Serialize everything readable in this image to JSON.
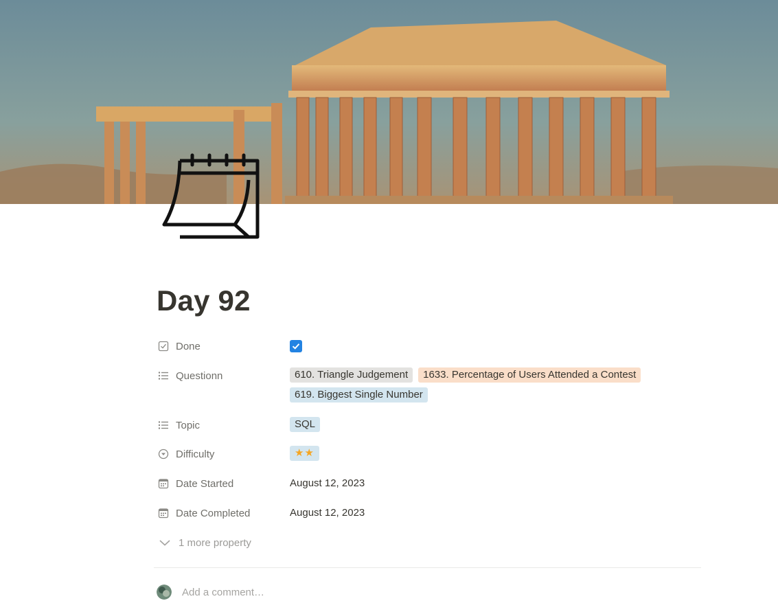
{
  "page": {
    "title": "Day 92",
    "icon": "calendar-icon",
    "cover": "parthenon-painting"
  },
  "properties": {
    "done": {
      "label": "Done",
      "icon": "checkbox-icon",
      "checked": true
    },
    "question": {
      "label": "Questionn",
      "icon": "list-icon",
      "tags": [
        {
          "text": "610. Triangle Judgement",
          "color": "#e3e2e0"
        },
        {
          "text": "1633. Percentage of Users Attended a Contest",
          "color": "#fadec9"
        },
        {
          "text": "619. Biggest Single Number",
          "color": "#d3e5ef"
        }
      ]
    },
    "topic": {
      "label": "Topic",
      "icon": "list-icon",
      "tags": [
        {
          "text": "SQL",
          "color": "#d3e5ef"
        }
      ]
    },
    "difficulty": {
      "label": "Difficulty",
      "icon": "select-icon",
      "value": "★★",
      "color": "#d3e5ef",
      "star_color": "#f5a623"
    },
    "date_started": {
      "label": "Date Started",
      "icon": "calendar-small-icon",
      "value": "August 12, 2023"
    },
    "date_completed": {
      "label": "Date Completed",
      "icon": "calendar-small-icon",
      "value": "August 12, 2023"
    }
  },
  "more_properties": {
    "label": "1 more property",
    "icon": "chevron-down-icon"
  },
  "comment": {
    "placeholder": "Add a comment…"
  }
}
